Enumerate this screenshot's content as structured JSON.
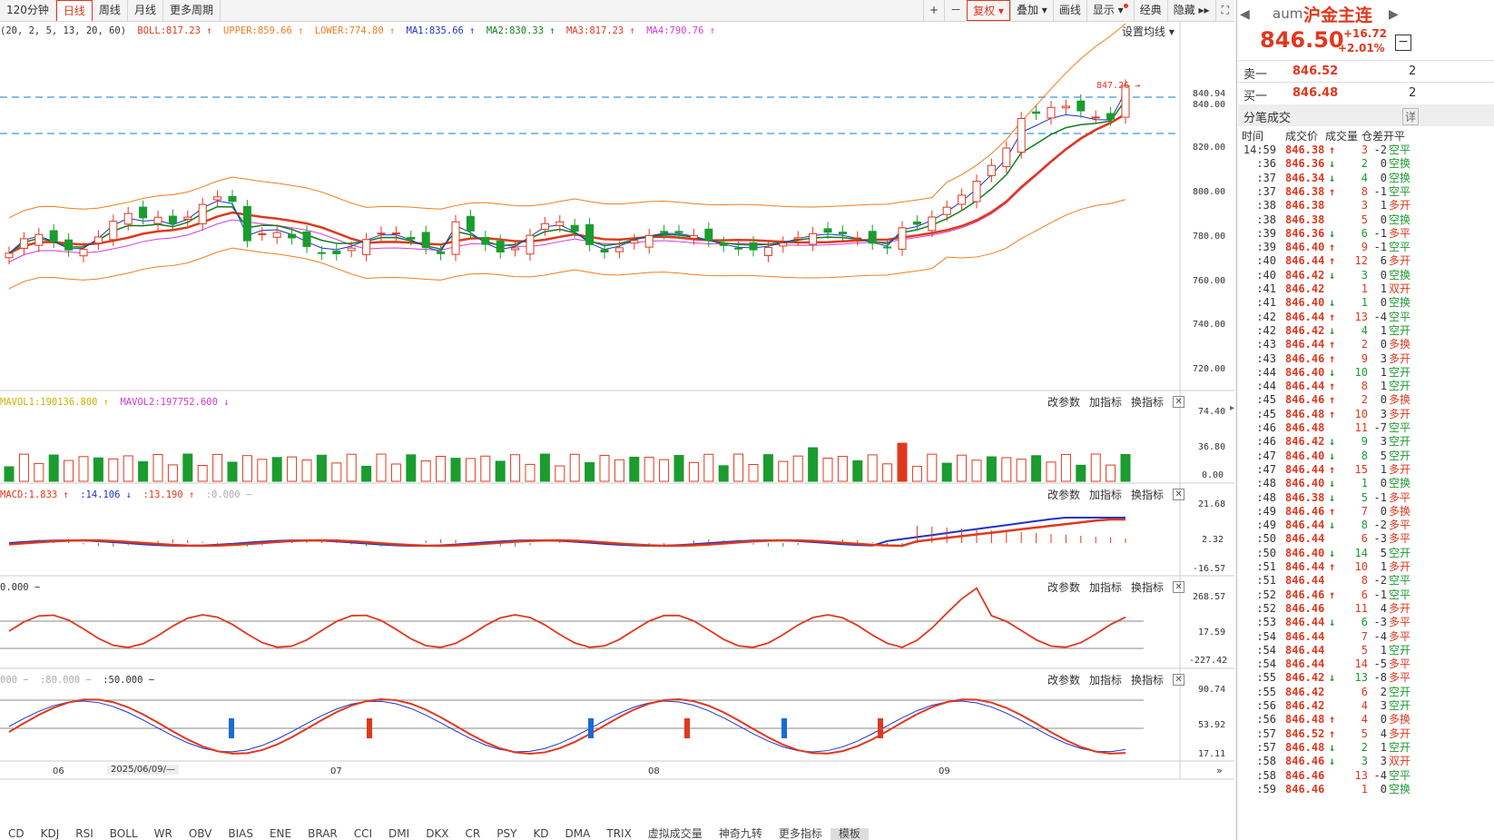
{
  "toolbar": {
    "periods": [
      "120分钟",
      "日线",
      "周线",
      "月线",
      "更多周期"
    ],
    "active_period": "日线",
    "right_buttons": [
      "+",
      "－",
      "复权",
      "叠加",
      "画线",
      "显示",
      "经典",
      "隐藏"
    ],
    "adj_label": "复权"
  },
  "main_legend": {
    "boll_params": "(20, 2, 5, 13, 20, 60)",
    "boll": "BOLL:817.23",
    "upper": "UPPER:859.66",
    "lower": "LOWER:774.80",
    "ma1": "MA1:835.66",
    "ma2": "MA2:830.33",
    "ma3": "MA3:817.23",
    "ma4": "MA4:790.76",
    "set_ma": "设置均线"
  },
  "price_axis": [
    "840.94",
    "840.00",
    "820.00",
    "800.00",
    "780.00",
    "760.00",
    "740.00",
    "720.00"
  ],
  "high_marker": "847.26",
  "vol_legend": {
    "mavol1": "MAVOL1:190136.800",
    "mavol2": "MAVOL2:197752.600"
  },
  "vol_axis": [
    "74.40",
    "36.80",
    "0.00"
  ],
  "macd_legend": {
    "macd": "MACD:1.833",
    "dif": ":14.106",
    "dea": ":13.190",
    "zero": ":0.000"
  },
  "macd_axis": [
    "21.68",
    "2.32",
    "-16.57"
  ],
  "cci_legend": {
    "v": "0.000"
  },
  "cci_axis": [
    "268.57",
    "17.59",
    "-227.42"
  ],
  "kdj_legend": {
    "a": "000",
    "b": ":80.000",
    "c": ":50.000"
  },
  "kdj_axis": [
    "90.74",
    "53.92",
    "17.11"
  ],
  "panel_ctrls": {
    "params": "改参数",
    "add": "加指标",
    "swap": "换指标"
  },
  "date_axis": {
    "d06": "06",
    "cursor_date": "2025/06/09/—",
    "d07": "07",
    "d08": "08",
    "d09": "09"
  },
  "bottom_tabs": [
    "CD",
    "KDJ",
    "RSI",
    "BOLL",
    "WR",
    "OBV",
    "BIAS",
    "ENE",
    "BRAR",
    "CCI",
    "DMI",
    "DKX",
    "CR",
    "PSY",
    "KD",
    "DMA",
    "TRIX",
    "虚拟成交量",
    "神奇九转",
    "更多指标",
    "模板"
  ],
  "quote": {
    "code": "aum",
    "name": "沪金主连",
    "price": "846.50",
    "change": "+16.72",
    "pct": "+2.01%",
    "sell_label": "卖一",
    "sell_price": "846.52",
    "sell_vol": "2",
    "buy_label": "买一",
    "buy_price": "846.48",
    "buy_vol": "2",
    "ticks_title": "分笔成交",
    "detail": "详",
    "headers": [
      "时间",
      "成交价",
      "成交量",
      "仓差",
      "开平"
    ]
  },
  "ticks": [
    [
      "14:59",
      "846.38",
      "up",
      "3",
      "-2",
      "空平"
    ],
    [
      ":36",
      "846.36",
      "dn",
      "2",
      "0",
      "空换"
    ],
    [
      ":37",
      "846.34",
      "dn",
      "4",
      "0",
      "空换"
    ],
    [
      ":37",
      "846.38",
      "up",
      "8",
      "-1",
      "空平"
    ],
    [
      ":38",
      "846.38",
      "",
      "3",
      "1",
      "多开"
    ],
    [
      ":38",
      "846.38",
      "",
      "5",
      "0",
      "空换"
    ],
    [
      ":39",
      "846.36",
      "dn",
      "6",
      "-1",
      "多平"
    ],
    [
      ":39",
      "846.40",
      "up",
      "9",
      "-1",
      "空平"
    ],
    [
      ":40",
      "846.44",
      "up",
      "12",
      "6",
      "多开"
    ],
    [
      ":40",
      "846.42",
      "dn",
      "3",
      "0",
      "空换"
    ],
    [
      ":41",
      "846.42",
      "",
      "1",
      "1",
      "双开"
    ],
    [
      ":41",
      "846.40",
      "dn",
      "1",
      "0",
      "空换"
    ],
    [
      ":42",
      "846.44",
      "up",
      "13",
      "-4",
      "空平"
    ],
    [
      ":42",
      "846.42",
      "dn",
      "4",
      "1",
      "空开"
    ],
    [
      ":43",
      "846.44",
      "up",
      "2",
      "0",
      "多换"
    ],
    [
      ":43",
      "846.46",
      "up",
      "9",
      "3",
      "多开"
    ],
    [
      ":44",
      "846.40",
      "dn",
      "10",
      "1",
      "空开"
    ],
    [
      ":44",
      "846.44",
      "up",
      "8",
      "1",
      "空开"
    ],
    [
      ":45",
      "846.46",
      "up",
      "2",
      "0",
      "多换"
    ],
    [
      ":45",
      "846.48",
      "up",
      "10",
      "3",
      "多开"
    ],
    [
      ":46",
      "846.48",
      "",
      "11",
      "-7",
      "空平"
    ],
    [
      ":46",
      "846.42",
      "dn",
      "9",
      "3",
      "空开"
    ],
    [
      ":47",
      "846.40",
      "dn",
      "8",
      "5",
      "空开"
    ],
    [
      ":47",
      "846.44",
      "up",
      "15",
      "1",
      "多开"
    ],
    [
      ":48",
      "846.40",
      "dn",
      "1",
      "0",
      "空换"
    ],
    [
      ":48",
      "846.38",
      "dn",
      "5",
      "-1",
      "多平"
    ],
    [
      ":49",
      "846.46",
      "up",
      "7",
      "0",
      "多换"
    ],
    [
      ":49",
      "846.44",
      "dn",
      "8",
      "-2",
      "多平"
    ],
    [
      ":50",
      "846.44",
      "",
      "6",
      "-3",
      "多平"
    ],
    [
      ":50",
      "846.40",
      "dn",
      "14",
      "5",
      "空开"
    ],
    [
      ":51",
      "846.44",
      "up",
      "10",
      "1",
      "多开"
    ],
    [
      ":51",
      "846.44",
      "",
      "8",
      "-2",
      "空平"
    ],
    [
      ":52",
      "846.46",
      "up",
      "6",
      "-1",
      "空平"
    ],
    [
      ":52",
      "846.46",
      "",
      "11",
      "4",
      "多开"
    ],
    [
      ":53",
      "846.44",
      "dn",
      "6",
      "-3",
      "多平"
    ],
    [
      ":54",
      "846.44",
      "",
      "7",
      "-4",
      "多平"
    ],
    [
      ":54",
      "846.44",
      "",
      "5",
      "1",
      "空开"
    ],
    [
      ":54",
      "846.44",
      "",
      "14",
      "-5",
      "多平"
    ],
    [
      ":55",
      "846.42",
      "dn",
      "13",
      "-8",
      "多平"
    ],
    [
      ":55",
      "846.42",
      "",
      "6",
      "2",
      "空开"
    ],
    [
      ":56",
      "846.42",
      "",
      "4",
      "3",
      "空开"
    ],
    [
      ":56",
      "846.48",
      "up",
      "4",
      "0",
      "多换"
    ],
    [
      ":57",
      "846.52",
      "up",
      "5",
      "4",
      "多开"
    ],
    [
      ":57",
      "846.48",
      "dn",
      "2",
      "1",
      "空开"
    ],
    [
      ":58",
      "846.46",
      "dn",
      "3",
      "3",
      "双开"
    ],
    [
      ":58",
      "846.46",
      "",
      "13",
      "-4",
      "空平"
    ],
    [
      ":59",
      "846.46",
      "",
      "1",
      "0",
      "空换"
    ]
  ],
  "colors": {
    "up": "#e0381e",
    "down": "#1a9c2e",
    "accent": "#e0381e"
  }
}
